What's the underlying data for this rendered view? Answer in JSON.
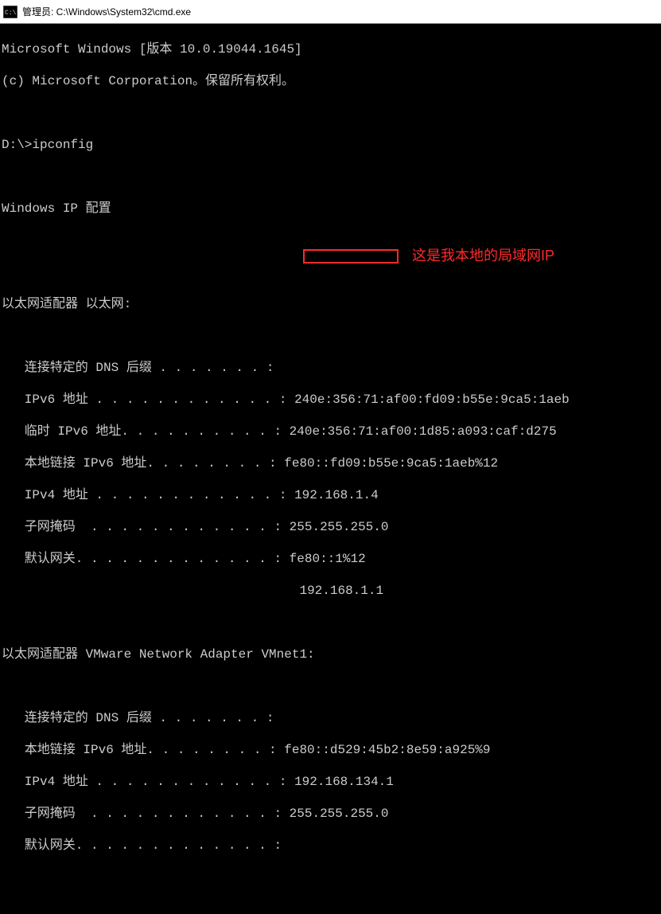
{
  "titlebar": {
    "title": "管理员: C:\\Windows\\System32\\cmd.exe"
  },
  "terminal": {
    "version_line": "Microsoft Windows [版本 10.0.19044.1645]",
    "copyright_line": "(c) Microsoft Corporation。保留所有权利。",
    "prompt": "D:\\>",
    "command": "ipconfig",
    "ipconfig_header": "Windows IP 配置",
    "adapter1": {
      "header": "以太网适配器 以太网:",
      "dns_suffix_label": "   连接特定的 DNS 后缀 . . . . . . . :",
      "ipv6_label": "   IPv6 地址 . . . . . . . . . . . . : ",
      "ipv6_value": "240e:356:71:af00:fd09:b55e:9ca5:1aeb",
      "temp_ipv6_label": "   临时 IPv6 地址. . . . . . . . . . : ",
      "temp_ipv6_value": "240e:356:71:af00:1d85:a093:caf:d275",
      "link_ipv6_label": "   本地链接 IPv6 地址. . . . . . . . : ",
      "link_ipv6_value": "fe80::fd09:b55e:9ca5:1aeb%12",
      "ipv4_label": "   IPv4 地址 . . . . . . . . . . . . : ",
      "ipv4_value": "192.168.1.4",
      "subnet_label": "   子网掩码  . . . . . . . . . . . . : ",
      "subnet_value": "255.255.255.0",
      "gateway_label": "   默认网关. . . . . . . . . . . . . : ",
      "gateway_value1": "fe80::1%12",
      "gateway_value2_pad": "                                       ",
      "gateway_value2": "192.168.1.1"
    },
    "adapter2": {
      "header": "以太网适配器 VMware Network Adapter VMnet1:",
      "dns_suffix_label": "   连接特定的 DNS 后缀 . . . . . . . :",
      "link_ipv6_label": "   本地链接 IPv6 地址. . . . . . . . : ",
      "link_ipv6_value": "fe80::d529:45b2:8e59:a925%9",
      "ipv4_label": "   IPv4 地址 . . . . . . . . . . . . : ",
      "ipv4_value": "192.168.134.1",
      "subnet_label": "   子网掩码  . . . . . . . . . . . . : ",
      "subnet_value": "255.255.255.0",
      "gateway_label": "   默认网关. . . . . . . . . . . . . :"
    }
  },
  "annotation": {
    "text": "这是我本地的局域网IP"
  }
}
